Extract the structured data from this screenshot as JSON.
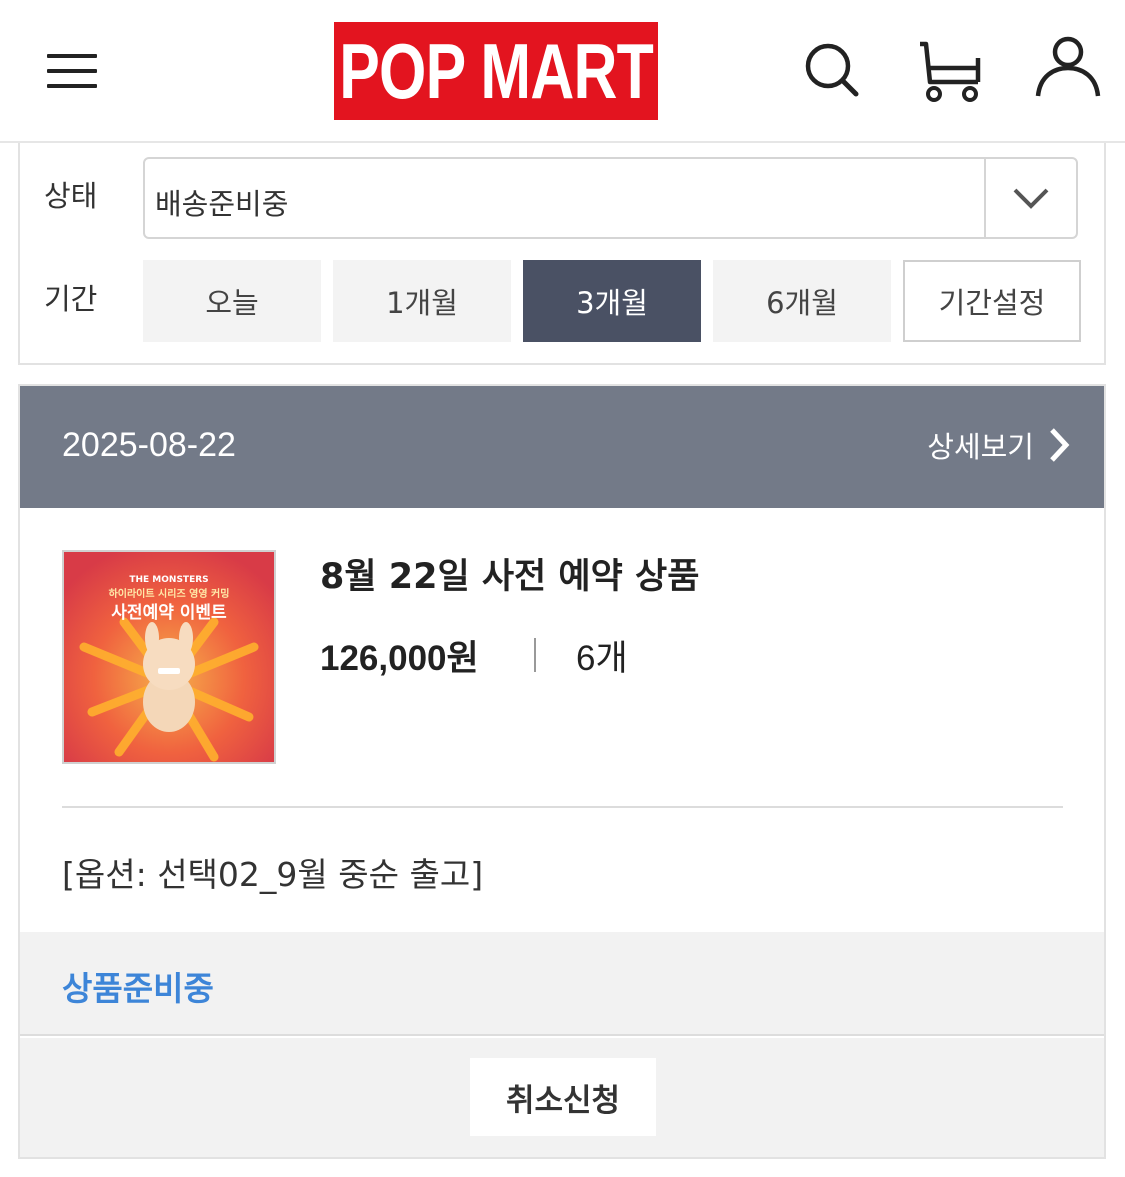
{
  "header": {
    "logo_text": "POP MART",
    "brand_color": "#e3141f",
    "icons": [
      "menu-icon",
      "search-icon",
      "cart-icon",
      "user-icon"
    ]
  },
  "filter": {
    "status_label": "상태",
    "status_value": "배송준비중",
    "period_label": "기간",
    "periods": [
      {
        "label": "오늘",
        "active": false
      },
      {
        "label": "1개월",
        "active": false
      },
      {
        "label": "3개월",
        "active": true
      },
      {
        "label": "6개월",
        "active": false
      },
      {
        "label": "기간설정",
        "active": false
      }
    ],
    "active_color": "#4a5164"
  },
  "order": {
    "date": "2025-08-22",
    "detail_label": "상세보기",
    "product_name": "8월 22일 사전 예약 상품",
    "price": "126,000원",
    "quantity": "6개",
    "option": "[옵션: 선택02_9월 중순 출고]",
    "status": "상품준비중",
    "status_color": "#3d85d8",
    "cancel_label": "취소신청",
    "thumbnail": {
      "line1": "THE MONSTERS",
      "line2": "하이라이트 시리즈 영영 커밍",
      "line3": "사전예약 이벤트"
    }
  }
}
